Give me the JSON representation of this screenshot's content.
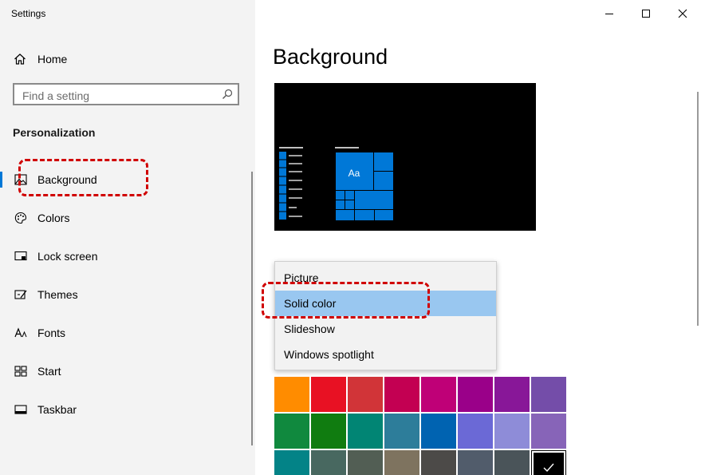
{
  "window": {
    "title": "Settings"
  },
  "nav": {
    "home_label": "Home",
    "search_placeholder": "Find a setting",
    "section_title": "Personalization",
    "items": [
      {
        "label": "Background",
        "icon": "picture-icon",
        "selected": true
      },
      {
        "label": "Colors",
        "icon": "palette-icon"
      },
      {
        "label": "Lock screen",
        "icon": "lock-screen-icon"
      },
      {
        "label": "Themes",
        "icon": "themes-icon"
      },
      {
        "label": "Fonts",
        "icon": "fonts-icon"
      },
      {
        "label": "Start",
        "icon": "start-icon"
      },
      {
        "label": "Taskbar",
        "icon": "taskbar-icon"
      }
    ]
  },
  "main": {
    "title": "Background",
    "preview_sample_text": "Aa",
    "background_dropdown": {
      "options": [
        "Picture",
        "Solid color",
        "Slideshow",
        "Windows spotlight"
      ],
      "selected": "Solid color"
    },
    "color_swatches": [
      [
        "#ff8c00",
        "#e81123",
        "#d13438",
        "#c30052",
        "#bf0077",
        "#9a0089",
        "#881798",
        "#744da9"
      ],
      [
        "#10893e",
        "#107c10",
        "#018574",
        "#2d7d9a",
        "#0063b1",
        "#6b69d6",
        "#8e8cd8",
        "#8764b8"
      ],
      [
        "#038387",
        "#486860",
        "#525e54",
        "#7e735f",
        "#4c4a48",
        "#515c6b",
        "#4a5459",
        "#000000"
      ]
    ],
    "selected_swatch": "#000000"
  },
  "colors": {
    "accent": "#0078d7",
    "annotation": "#d00000"
  }
}
